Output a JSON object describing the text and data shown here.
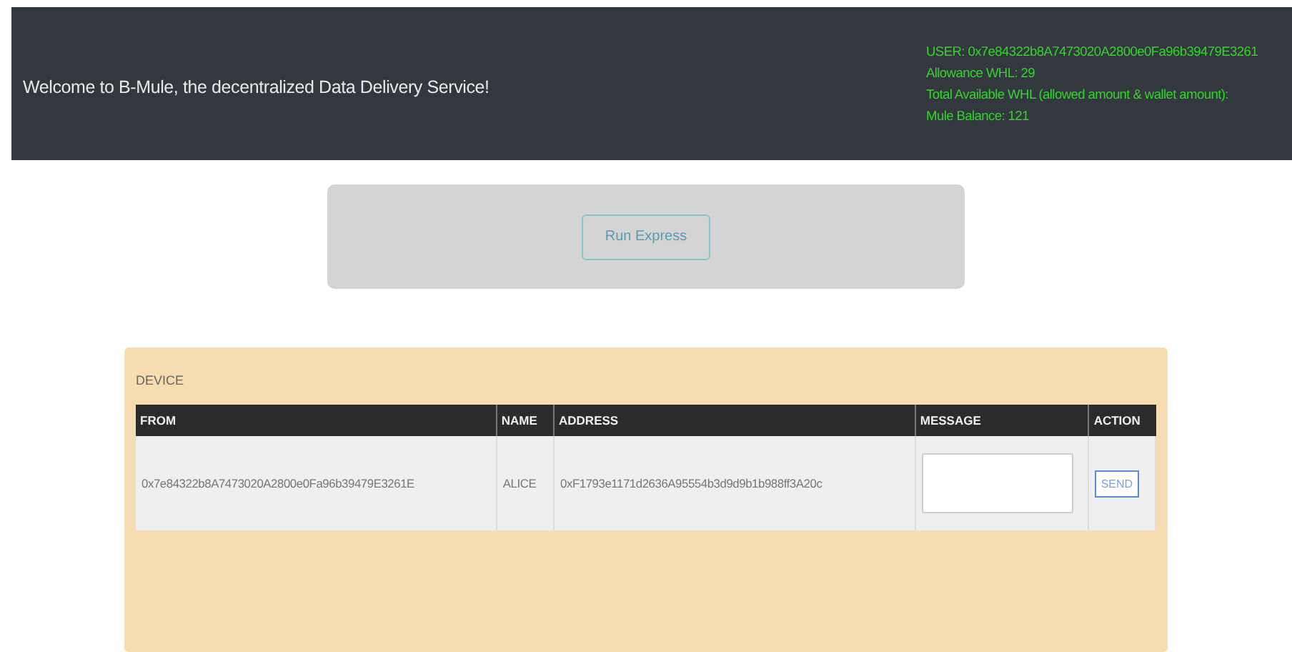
{
  "header": {
    "welcome": "Welcome to B-Mule, the decentralized Data Delivery Service!",
    "info": [
      "USER: 0x7e84322b8A7473020A2800e0Fa96b39479E3261",
      "Allowance WHL: 29",
      "Total Available WHL (allowed amount & wallet amount):",
      "Mule Balance: 121"
    ]
  },
  "express": {
    "button": "Run Express"
  },
  "device": {
    "title": "DEVICE",
    "columns": [
      "FROM",
      "NAME",
      "ADDRESS",
      "MESSAGE",
      "ACTION"
    ],
    "rows": [
      {
        "from": "0x7e84322b8A7473020A2800e0Fa96b39479E3261E",
        "name": "ALICE",
        "address": "0xF1793e1171d2636A95554b3d9d9b1b988ff3A20c",
        "action": "SEND"
      }
    ]
  }
}
